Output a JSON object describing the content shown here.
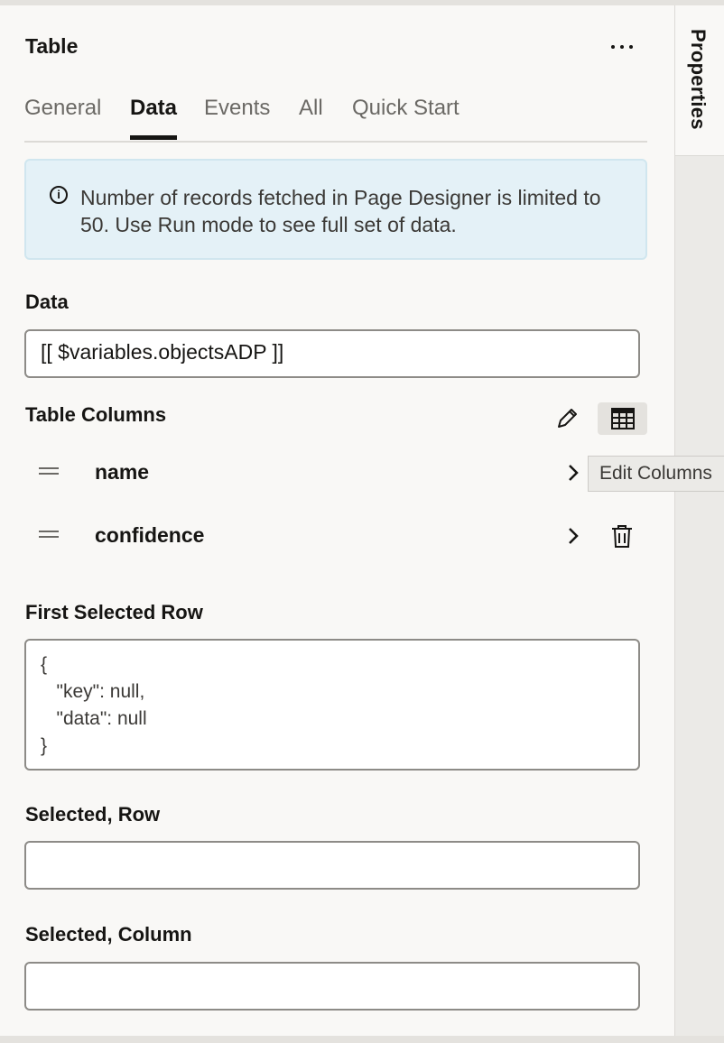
{
  "panel": {
    "title": "Table",
    "rail_label": "Properties"
  },
  "tabs": [
    {
      "label": "General"
    },
    {
      "label": "Data"
    },
    {
      "label": "Events"
    },
    {
      "label": "All"
    },
    {
      "label": "Quick Start"
    }
  ],
  "active_tab": "Data",
  "info": {
    "icon": "info-icon",
    "message": "Number of records fetched in Page Designer is limited to 50. Use Run mode to see full set of data."
  },
  "data_field": {
    "label": "Data",
    "value": "[[ $variables.objectsADP ]]"
  },
  "table_columns": {
    "label": "Table Columns",
    "columns": [
      {
        "name": "name"
      },
      {
        "name": "confidence"
      }
    ],
    "tooltip": "Edit Columns"
  },
  "first_selected_row": {
    "label": "First Selected Row",
    "lines": [
      "{",
      "   \"key\": null,",
      "   \"data\": null",
      "}"
    ]
  },
  "selected_row": {
    "label": "Selected, Row",
    "value": ""
  },
  "selected_column": {
    "label": "Selected, Column",
    "value": ""
  }
}
